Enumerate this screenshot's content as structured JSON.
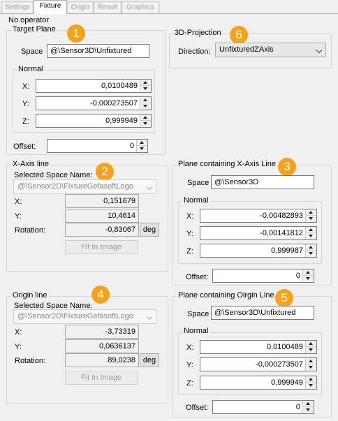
{
  "tabs": [
    "Settings",
    "Fixture",
    "Origin",
    "Result",
    "Graphics"
  ],
  "operator_label": "No operator",
  "target_plane": {
    "title": "Target Plane",
    "space_label": "Space",
    "space_value": "@\\Sensor3D\\Unfixtured",
    "normal_title": "Normal",
    "x_label": "X:",
    "x_value": "0,0100489",
    "y_label": "Y:",
    "y_value": "-0,000273507",
    "z_label": "Z:",
    "z_value": "0,999949",
    "offset_label": "Offset:",
    "offset_value": "0"
  },
  "projection": {
    "title": "3D-Projection",
    "direction_label": "Direction:",
    "direction_value": "UnfixturedZAxis"
  },
  "x_axis_line": {
    "title": "X-Axis line",
    "space_name_label": "Selected Space Name:",
    "space_value": "@\\Sensor2D\\FixtureGefasoftLogo",
    "x_label": "X:",
    "x_value": "0,151679",
    "y_label": "Y:",
    "y_value": "10,4614",
    "rotation_label": "Rotation:",
    "rotation_value": "-0,83067",
    "deg_label": "deg",
    "fit_label": "Fit In Image"
  },
  "plane_x_axis": {
    "title": "Plane containing X-Axis Line",
    "space_label": "Space",
    "space_value": "@\\Sensor3D",
    "normal_title": "Normal",
    "x_label": "X:",
    "x_value": "-0,00482893",
    "y_label": "Y:",
    "y_value": "-0,00141812",
    "z_label": "Z:",
    "z_value": "0,999987",
    "offset_label": "Offset:",
    "offset_value": "0"
  },
  "origin_line": {
    "title": "Origin line",
    "space_name_label": "Selected Space Name:",
    "space_value": "@\\Sensor2D\\FixtureGefasoftLogo",
    "x_label": "X:",
    "x_value": "-3,73319",
    "y_label": "Y:",
    "y_value": "0,0636137",
    "rotation_label": "Rotation:",
    "rotation_value": "89,0238",
    "deg_label": "deg",
    "fit_label": "Fit In Image"
  },
  "plane_origin": {
    "title": "Plane containing Oirgin Line",
    "space_label": "Space",
    "space_value": "@\\Sensor3D\\Unfixtured",
    "normal_title": "Normal",
    "x_label": "X:",
    "x_value": "0,0100489",
    "y_label": "Y:",
    "y_value": "-0,000273507",
    "z_label": "Z:",
    "z_value": "0,999949",
    "offset_label": "Offset:",
    "offset_value": "0"
  },
  "badges": [
    "1",
    "2",
    "3",
    "4",
    "5",
    "6"
  ],
  "colors": {
    "badge": "#f5a31d",
    "background": "#f0f0f0"
  }
}
